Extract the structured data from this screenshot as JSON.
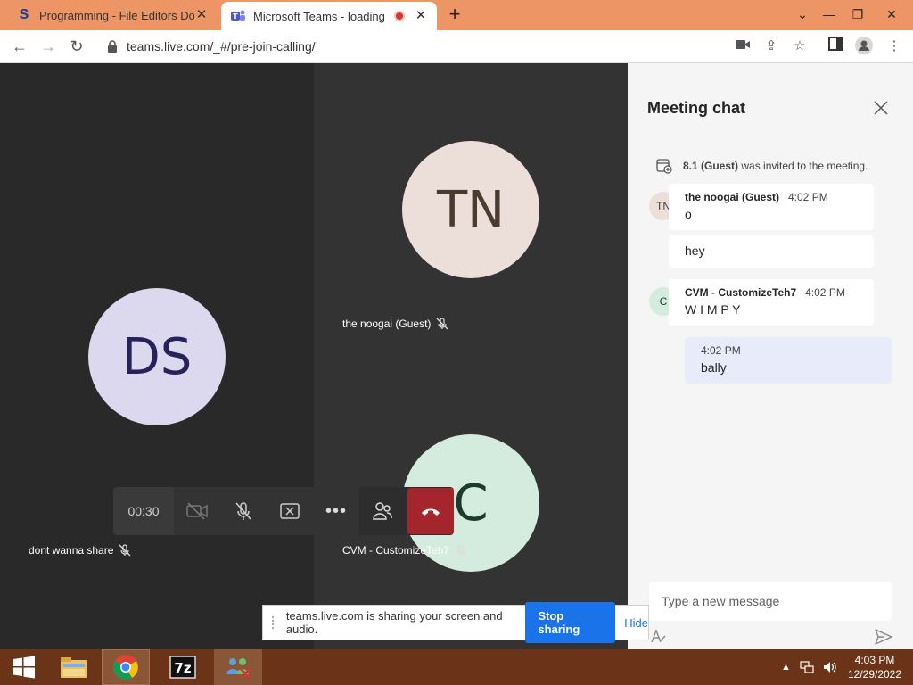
{
  "browser": {
    "tabs": [
      {
        "title": "Programming - File Editors Dow",
        "favicon": "S"
      },
      {
        "title": "Microsoft Teams - loading",
        "favicon": "teams-icon"
      }
    ],
    "url": "teams.live.com/_#/pre-join-calling/"
  },
  "stage": {
    "participants": [
      {
        "initials": "DS",
        "name": "dont wanna share",
        "color": "#dcd9ef",
        "text_color": "#27235a"
      },
      {
        "initials": "TN",
        "name": "the noogai (Guest)",
        "color": "#ecdfd9",
        "text_color": "#4b3a2f"
      },
      {
        "initials": "C",
        "name": "CVM - CustomizeTeh7",
        "color": "#d3ecdd",
        "text_color": "#1d3b2a"
      }
    ],
    "timer": "00:30"
  },
  "chat": {
    "title": "Meeting chat",
    "system_message": {
      "name": "8.1 (Guest)",
      "text": "was invited to the meeting."
    },
    "messages": [
      {
        "avatar": "TN",
        "sender": "the noogai (Guest)",
        "time": "4:02 PM",
        "text": "o"
      },
      {
        "text": "hey"
      },
      {
        "avatar": "C",
        "sender": "CVM - CustomizeTeh7",
        "time": "4:02 PM",
        "text": "W I M P Y"
      },
      {
        "time": "4:02 PM",
        "text": "bally"
      }
    ],
    "compose_placeholder": "Type a new message"
  },
  "sharebar": {
    "text": "teams.live.com is sharing your screen and audio.",
    "stop_label": "Stop sharing",
    "hide_label": "Hide"
  },
  "taskbar": {
    "time": "4:03 PM",
    "date": "12/29/2022"
  }
}
